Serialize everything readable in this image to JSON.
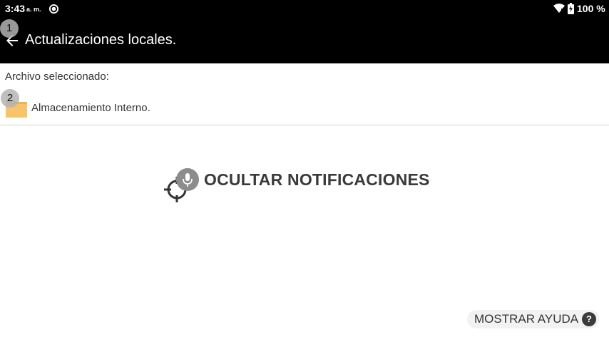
{
  "status_bar": {
    "time": "3:43",
    "ampm": "a. m.",
    "battery": "100 %"
  },
  "app_bar": {
    "title": "Actualizaciones locales."
  },
  "markers": [
    "1",
    "2"
  ],
  "content": {
    "selected_label": "Archivo seleccionado:",
    "storage_label": "Almacenamiento Interno.",
    "hide_notifications_label": "OCULTAR NOTIFICACIONES",
    "help_label": "MOSTRAR AYUDA",
    "help_icon_glyph": "?"
  },
  "icons": {
    "sync": "sync-icon",
    "wifi": "wifi-icon",
    "battery": "battery-icon",
    "back": "back-arrow-icon",
    "folder": "folder-icon",
    "target": "target-icon",
    "mic": "microphone-icon",
    "help": "help-icon"
  },
  "colors": {
    "app_bar": "#000000",
    "folder": "#f7c46c",
    "text": "#333333"
  }
}
